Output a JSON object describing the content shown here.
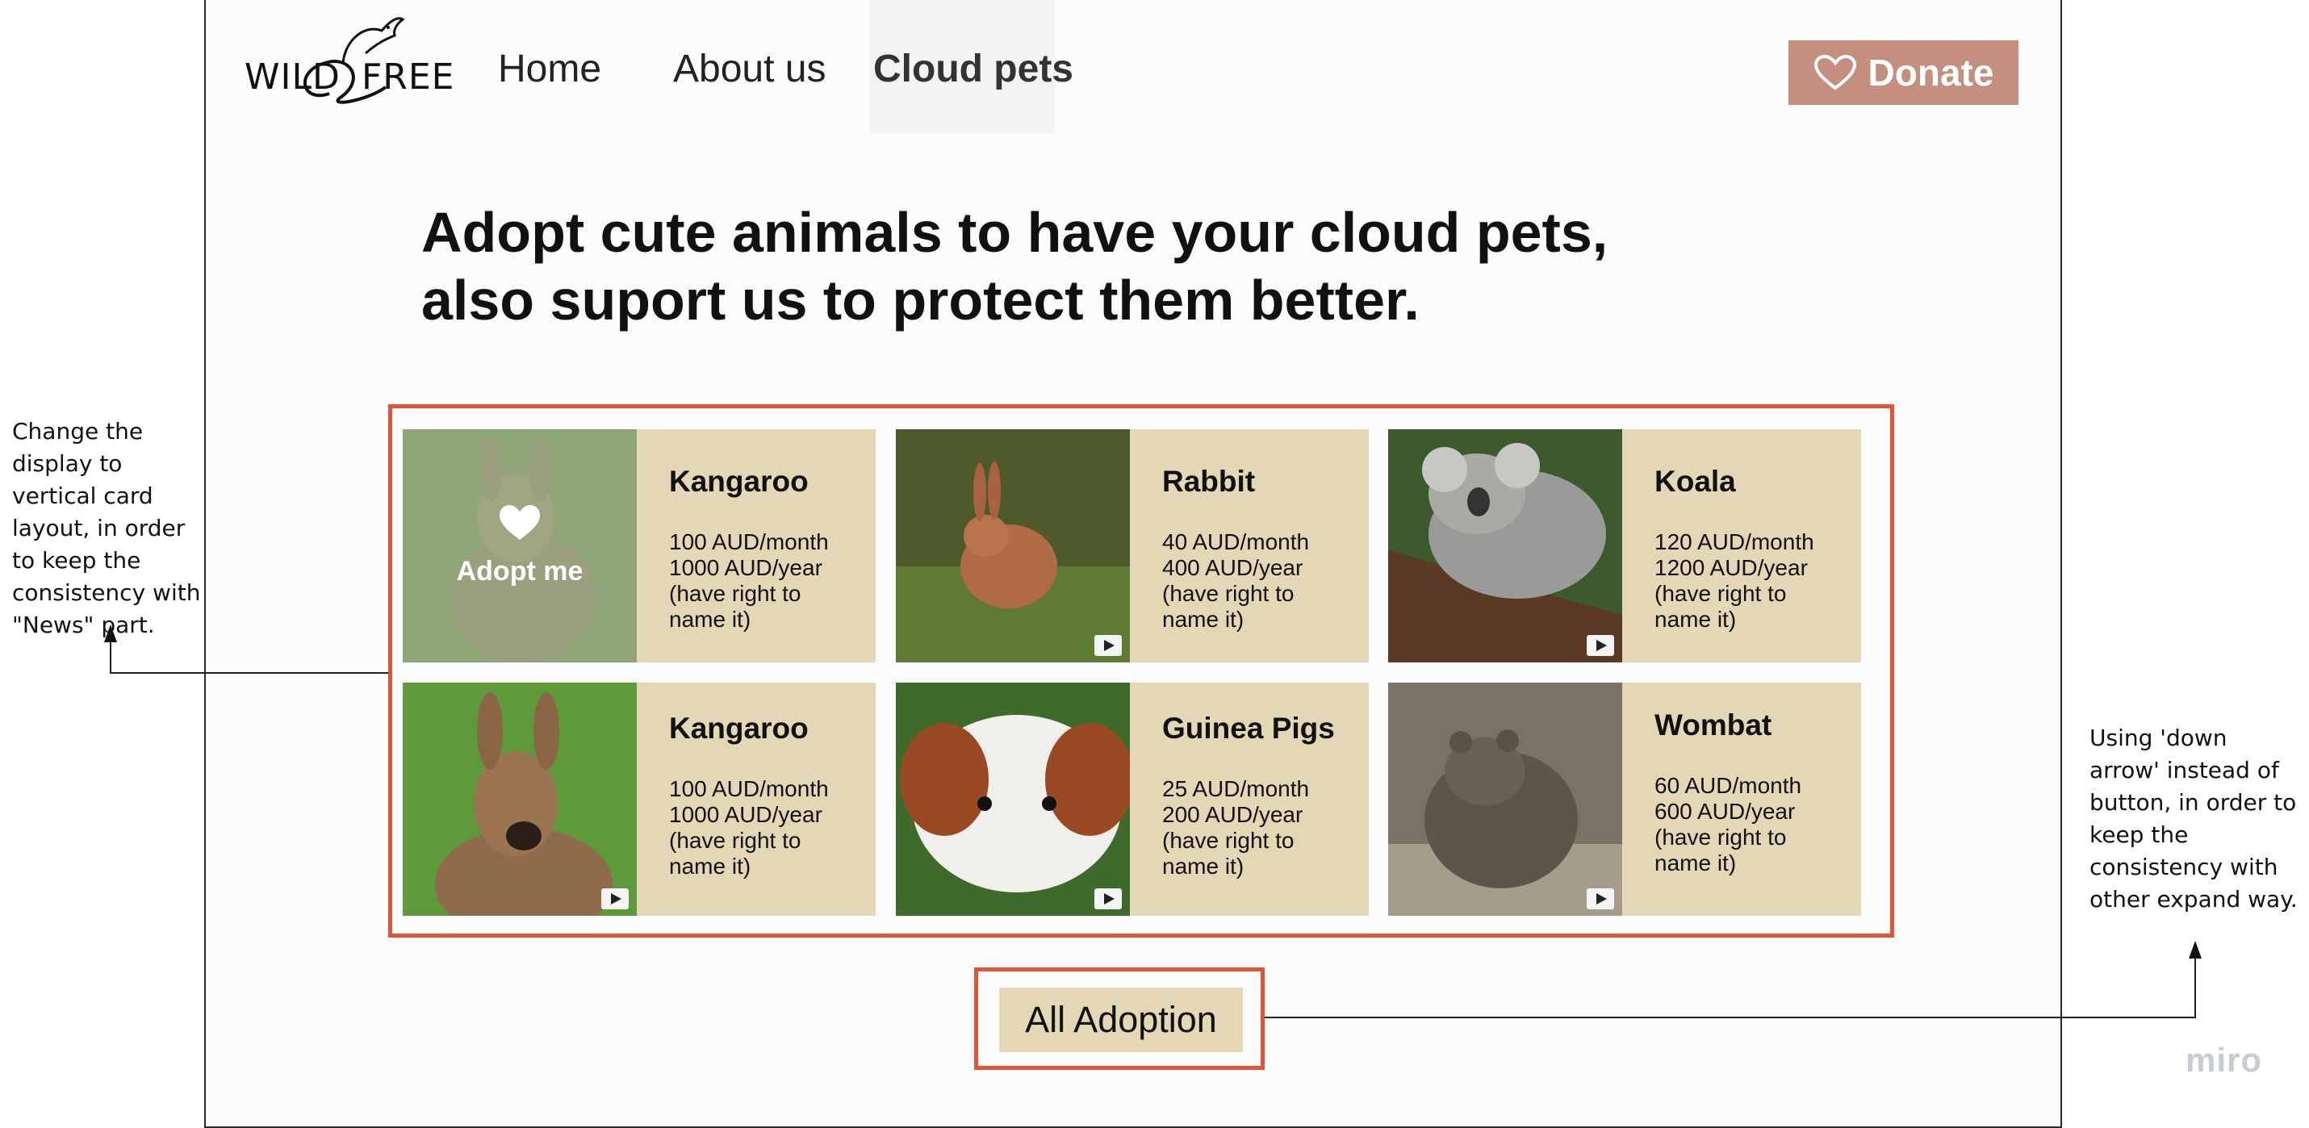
{
  "header": {
    "logo_left": "WILD",
    "logo_right": "FREE",
    "nav": [
      {
        "label": "Home"
      },
      {
        "label": "About us"
      },
      {
        "label": "Cloud pets"
      }
    ],
    "donate_label": "Donate"
  },
  "headline": {
    "line1": "Adopt cute animals to have your cloud pets,",
    "line2": "also suport us to protect them better."
  },
  "cards": [
    {
      "name": "Kangaroo",
      "price1": "100 AUD/month",
      "price2": "1000 AUD/year",
      "price3": "(have right to name it)",
      "overlay": "Adopt me"
    },
    {
      "name": "Rabbit",
      "price1": "40 AUD/month",
      "price2": "400 AUD/year",
      "price3": "(have right to name it)"
    },
    {
      "name": "Koala",
      "price1": "120 AUD/month",
      "price2": "1200 AUD/year",
      "price3": "(have right to name it)"
    },
    {
      "name": "Kangaroo",
      "price1": "100 AUD/month",
      "price2": "1000 AUD/year",
      "price3": "(have right to name it)"
    },
    {
      "name": "Guinea Pigs",
      "price1": "25 AUD/month",
      "price2": "200 AUD/year",
      "price3": "(have right to name it)"
    },
    {
      "name": "Wombat",
      "price1": "60 AUD/month",
      "price2": "600 AUD/year",
      "price3": "(have right to name it)"
    }
  ],
  "all_adoption_label": "All Adoption",
  "notes": {
    "left": "Change the display to vertical card layout, in order to keep the consistency with \"News\" part.",
    "right": "Using 'down arrow' instead of button, in order to keep the consistency with other expand way."
  },
  "watermark": "miro",
  "colors": {
    "accent_border": "#e0553a",
    "card_bg": "#e4d7b6",
    "donate_bg": "#c48f7f"
  }
}
